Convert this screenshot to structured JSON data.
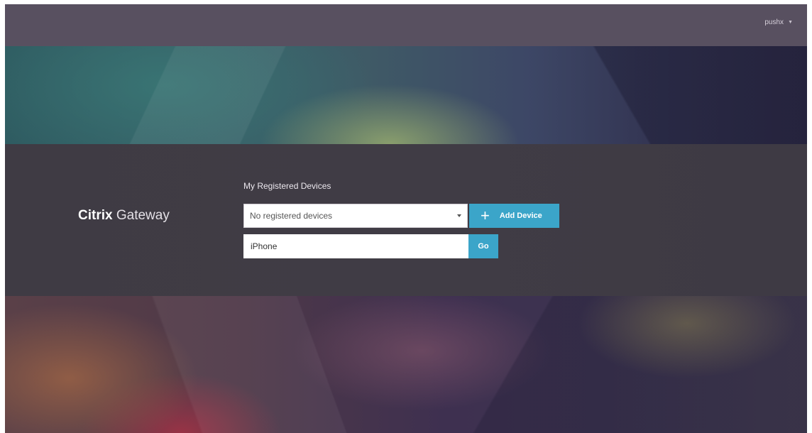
{
  "header": {
    "user_name": "pushx"
  },
  "brand": {
    "name_bold": "Citrix",
    "name_light": "Gateway"
  },
  "devices": {
    "section_title": "My Registered Devices",
    "select_value": "No registered devices",
    "add_device_label": "Add Device",
    "device_name_value": "iPhone",
    "go_label": "Go"
  },
  "colors": {
    "accent": "#3ba5c9",
    "topbar": "#585060",
    "band": "#403c45"
  },
  "icons": {
    "user_menu": "chevron-down-icon",
    "select": "dropdown-arrow-icon",
    "add": "plus-icon"
  }
}
